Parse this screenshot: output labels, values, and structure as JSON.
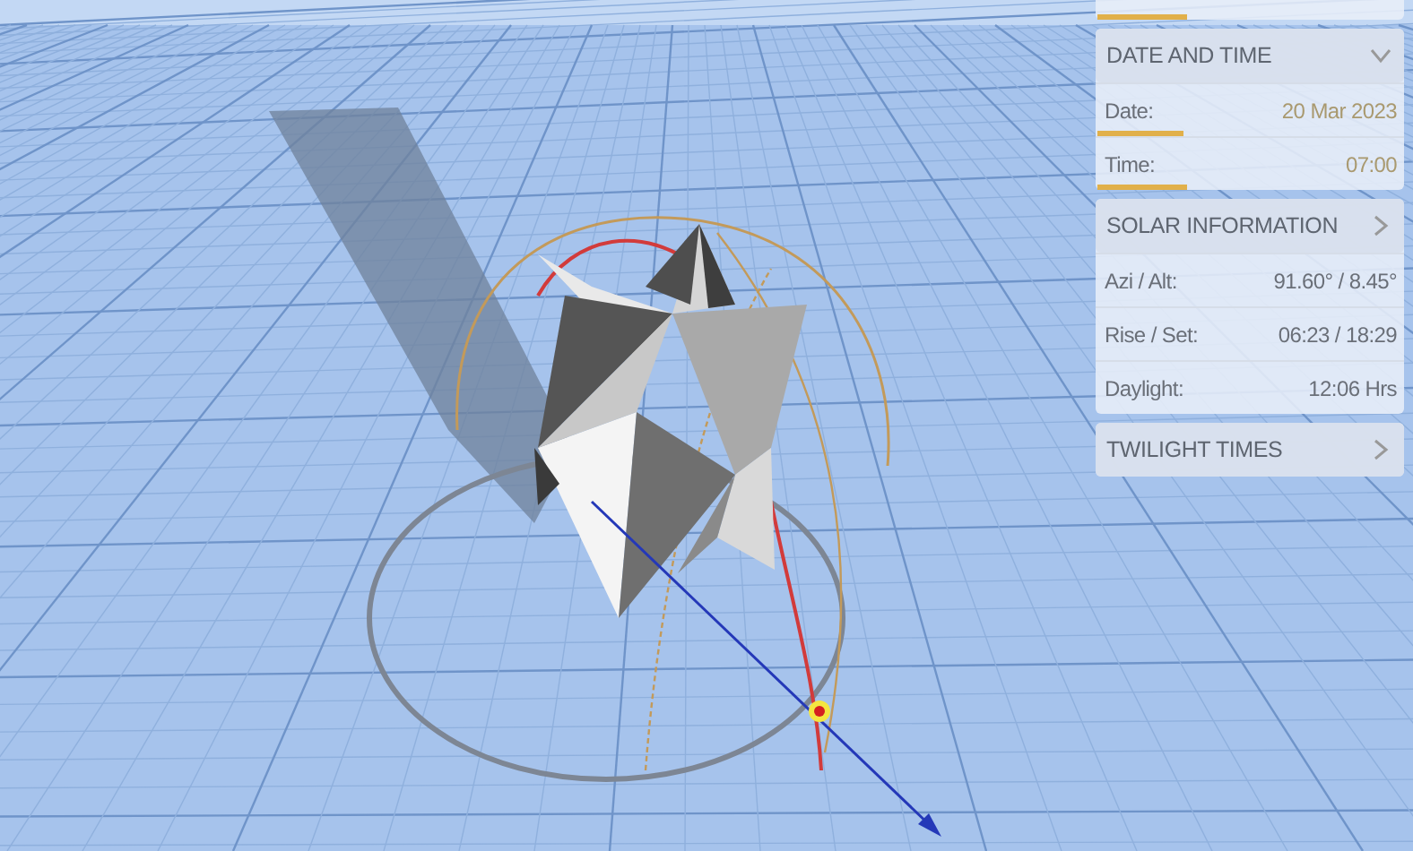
{
  "sections": [
    {
      "title": "DATE AND TIME",
      "expanded": true,
      "rows": [
        {
          "label": "Date:",
          "value": "20 Mar 2023",
          "editable": true
        },
        {
          "label": "Time:",
          "value": "07:00",
          "editable": true
        }
      ]
    },
    {
      "title": "SOLAR INFORMATION",
      "expanded": false,
      "rows": [
        {
          "label": "Azi / Alt:",
          "value": "91.60° / 8.45°",
          "editable": false
        },
        {
          "label": "Rise / Set:",
          "value": "06:23 / 18:29",
          "editable": false
        },
        {
          "label": "Daylight:",
          "value": "12:06 Hrs",
          "editable": false
        }
      ]
    },
    {
      "title": "TWILIGHT TIMES",
      "expanded": false
    }
  ]
}
